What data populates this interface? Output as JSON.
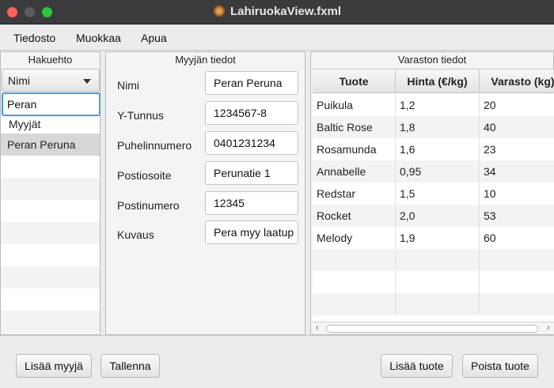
{
  "window": {
    "title": "LahiruokaView.fxml"
  },
  "menu": [
    "Tiedosto",
    "Muokkaa",
    "Apua"
  ],
  "search_panel": {
    "title": "Hakuehto",
    "field_select": "Nimi",
    "search_value": "Peran",
    "list_header": "Myyjät",
    "results": [
      "Peran Peruna"
    ]
  },
  "seller_panel": {
    "title": "Myyjän tiedot",
    "fields": [
      {
        "label": "Nimi",
        "value": "Peran Peruna"
      },
      {
        "label": "Y-Tunnus",
        "value": "1234567-8"
      },
      {
        "label": "Puhelinnumero",
        "value": "0401231234"
      },
      {
        "label": "Postiosoite",
        "value": "Perunatie 1"
      },
      {
        "label": "Postinumero",
        "value": "12345"
      },
      {
        "label": "Kuvaus",
        "value": "Pera myy laatup"
      }
    ]
  },
  "stock_panel": {
    "title": "Varaston tiedot",
    "columns": [
      "Tuote",
      "Hinta (€/kg)",
      "Varasto (kg)"
    ],
    "rows": [
      [
        "Puikula",
        "1,2",
        "20"
      ],
      [
        "Baltic Rose",
        "1,8",
        "40"
      ],
      [
        "Rosamunda",
        "1,6",
        "23"
      ],
      [
        "Annabelle",
        "0,95",
        "34"
      ],
      [
        "Redstar",
        "1,5",
        "10"
      ],
      [
        "Rocket",
        "2,0",
        "53"
      ],
      [
        "Melody",
        "1,9",
        "60"
      ]
    ]
  },
  "buttons": {
    "add_seller": "Lisää myyjä",
    "save": "Tallenna",
    "add_product": "Lisää tuote",
    "delete_product": "Poista tuote"
  },
  "colors": {
    "focus": "#4a9ae6",
    "selection": "#d7d7d7",
    "titlebar": "#3b3b3d"
  }
}
